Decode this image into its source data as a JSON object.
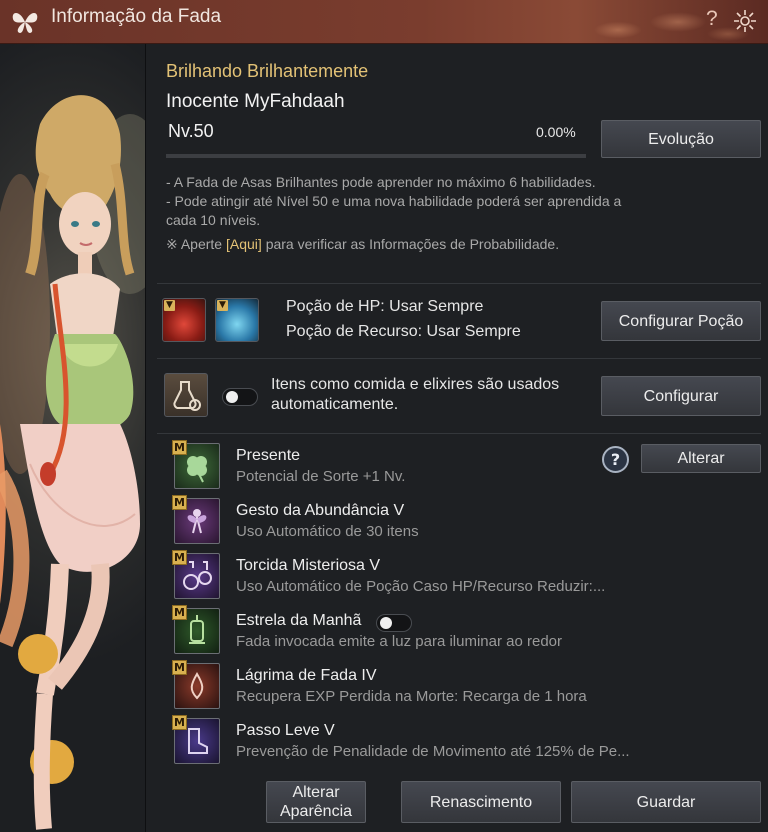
{
  "window": {
    "title": "Informação da Fada",
    "help_label": "?"
  },
  "fairy": {
    "rank": "Brilhando Brilhantemente",
    "name": "Inocente MyFahdaah",
    "level": "Nv.50",
    "exp_percent_text": "0.00%",
    "exp_fraction": 0.0,
    "evolve_label": "Evolução",
    "info_lines": [
      "- A Fada de Asas Brilhantes pode aprender no máximo 6 habilidades.",
      "- Pode atingir até Nível 50 e uma nova habilidade poderá ser aprendida a",
      "cada 10 níveis."
    ],
    "prob_prefix": "※ Aperte ",
    "prob_link": "[Aqui]",
    "prob_suffix": " para verificar as Informações de Probabilidade."
  },
  "potions": {
    "hp": "Poção de HP: Usar Sempre",
    "resource": "Poção de Recurso: Usar Sempre",
    "configure_label": "Configurar Poção"
  },
  "food": {
    "line1": "Itens como comida e elixires são usados",
    "line2": "automaticamente.",
    "toggle_on": false,
    "configure_label": "Configurar"
  },
  "skills": [
    {
      "name": "Presente",
      "desc": "Potencial de Sorte +1 Nv.",
      "badge": "M",
      "icon": "clover-icon"
    },
    {
      "name": "Gesto da Abundância V",
      "desc": "Uso Automático de 30 itens",
      "badge": "M",
      "icon": "fairy-icon"
    },
    {
      "name": "Torcida Misteriosa V",
      "desc": "Uso Automático de Poção Caso HP/Recurso Reduzir:...",
      "badge": "M",
      "icon": "potion-flask-icon"
    },
    {
      "name": "Estrela da Manhã",
      "desc": "Fada invocada emite a luz para iluminar ao redor",
      "badge": "M",
      "icon": "lantern-icon"
    },
    {
      "name": "Lágrima de Fada IV",
      "desc": "Recupera EXP Perdida na Morte: Recarga de 1 hora",
      "badge": "M",
      "icon": "tear-bottle-icon"
    },
    {
      "name": "Passo Leve V",
      "desc": "Prevenção de Penalidade de Movimento até 125% de Pe...",
      "badge": "M",
      "icon": "boot-icon"
    }
  ],
  "skill_help_label": "?",
  "change_label": "Alterar",
  "footer": {
    "appearance_line1": "Alterar",
    "appearance_line2": "Aparência",
    "rebirth_label": "Renascimento",
    "store_label": "Guardar"
  },
  "colors": {
    "title_bar": "#6a3328",
    "accent_gold": "#e3c276",
    "panel_bg": "#1e2023"
  }
}
